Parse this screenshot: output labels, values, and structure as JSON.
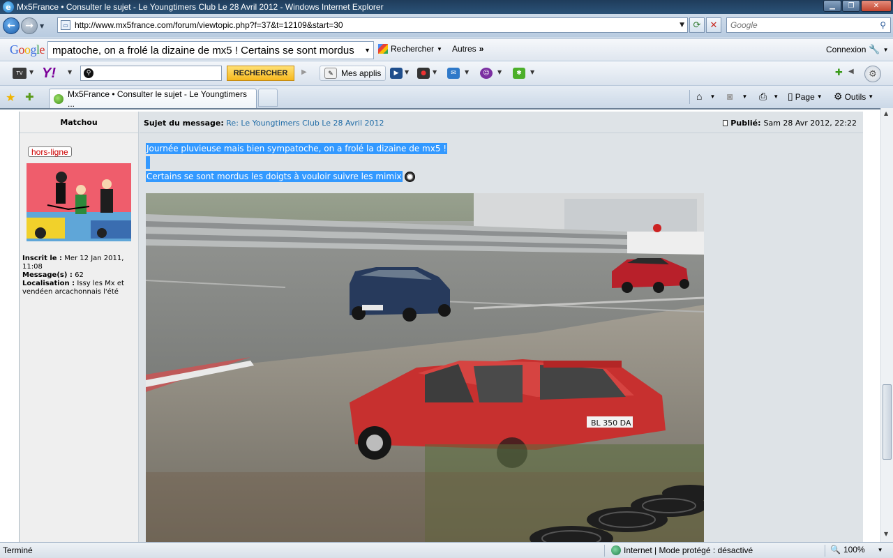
{
  "window": {
    "title": "Mx5France • Consulter le sujet - Le Youngtimers Club Le 28 Avril 2012 - Windows Internet Explorer"
  },
  "addressbar": {
    "url": "http://www.mx5france.com/forum/viewtopic.php?f=37&t=12109&start=30",
    "search_placeholder": "Google"
  },
  "google_toolbar": {
    "logo": "Google",
    "search_value": "mpatoche, on a frolé la dizaine de mx5 ! Certains se sont mordus",
    "rechercher": "Rechercher",
    "autres": "Autres",
    "connexion": "Connexion"
  },
  "yahoo_toolbar": {
    "logo": "Y!",
    "search_button": "RECHERCHER",
    "mes_applis": "Mes applis"
  },
  "tabs": {
    "active_tab": "Mx5France • Consulter le sujet - Le Youngtimers ...",
    "page_menu": "Page",
    "tools_menu": "Outils"
  },
  "post": {
    "author": "Matchou",
    "subject_label": "Sujet du message:",
    "subject": "Re: Le Youngtimers Club Le 28 Avril 2012",
    "published_label": "Publié:",
    "published_date": "Sam 28 Avr 2012, 22:22",
    "status": "hors-ligne",
    "inscrit_label": "Inscrit le :",
    "inscrit_value": "Mer 12 Jan 2011, 11:08",
    "messages_label": "Message(s) :",
    "messages_value": "62",
    "localisation_label": "Localisation :",
    "localisation_value": "Issy les Mx et vendéen arcachonnais l'été",
    "line1": "Journée pluvieuse mais bien sympatoche, on a frolé la dizaine de mx5 !",
    "line2": "Certains se sont mordus les doigts à vouloir suivre les mimix"
  },
  "photo": {
    "plate_front": "BL 350 DA",
    "plate_mid": "BF 362 NT"
  },
  "statusbar": {
    "status": "Terminé",
    "zone": "Internet | Mode protégé : désactivé",
    "zoom": "100%"
  }
}
